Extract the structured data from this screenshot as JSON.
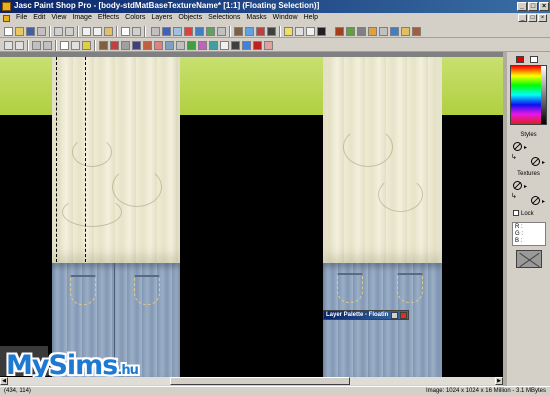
{
  "window": {
    "title": "Jasc Paint Shop Pro - [body-stdMatBaseTextureName* [1:1] (Floating Selection)]",
    "caption_buttons": [
      "_",
      "□",
      "×"
    ]
  },
  "menu": {
    "items": [
      "File",
      "Edit",
      "View",
      "Image",
      "Effects",
      "Colors",
      "Layers",
      "Objects",
      "Selections",
      "Masks",
      "Window",
      "Help"
    ],
    "mdi_buttons": [
      "_",
      "□",
      "×"
    ]
  },
  "layer_palette": {
    "title": "Layer Palette - Floatin"
  },
  "logo": {
    "text": "MySims",
    "suffix": ".hu"
  },
  "statusbar": {
    "coords": "(434, 114)",
    "image_info": "Image: 1024 x 1024 x 16 Million - 3.1 MBytes"
  },
  "right_panel": {
    "styles_label": "Styles",
    "textures_label": "Textures",
    "lock_label": "Lock",
    "rgb": [
      "R :",
      "G :",
      "B :"
    ],
    "fg_color": "#e00000",
    "bg_color": "#ffffff"
  },
  "icons": {
    "app": "paint-shop-pro-icon",
    "null_style": "null-style-icon",
    "swap": "swap-arrow-icon"
  }
}
